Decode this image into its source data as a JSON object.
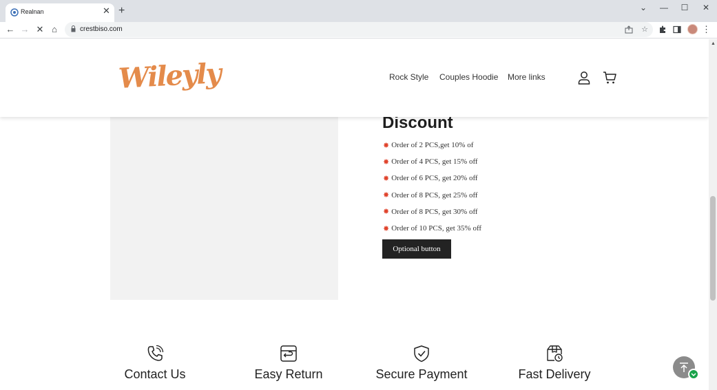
{
  "browser": {
    "tab_title": "Realnan",
    "tab_close": "✕",
    "new_tab": "+",
    "url": "crestbiso.com",
    "window_controls": {
      "chevron": "⌄",
      "minimize": "—",
      "maximize": "☐",
      "close": "✕"
    },
    "nav": {
      "back": "←",
      "forward": "→",
      "reload": "✕",
      "home": "⌂"
    },
    "icons": {
      "share": "share-icon",
      "bookmark": "star-icon",
      "extensions": "puzzle-icon",
      "sidepanel": "sidepanel-icon",
      "menu": "⋮"
    }
  },
  "header": {
    "logo_text": "Wileyly",
    "nav_links": [
      "Rock Style",
      "Couples Hoodie",
      "More links"
    ],
    "icons": {
      "account": "user-icon",
      "cart": "cart-icon"
    }
  },
  "discount": {
    "title": "Discount",
    "star_glyph": "✸",
    "items": [
      "Order of 2 PCS,get 10% of",
      "Order of 4 PCS, get 15% off",
      "Order of 6 PCS, get 20% off",
      "Order of 8 PCS, get 25% off",
      "Order of 8 PCS, get 30% off",
      "Order of 10 PCS, get 35% off"
    ],
    "button_label": "Optional button"
  },
  "features": [
    {
      "label": "Contact Us",
      "icon": "phone-icon"
    },
    {
      "label": "Easy Return",
      "icon": "return-box-icon"
    },
    {
      "label": "Secure Payment",
      "icon": "shield-check-icon"
    },
    {
      "label": "Fast Delivery",
      "icon": "delivery-box-icon"
    }
  ],
  "colors": {
    "logo": "#e48b4b",
    "button_bg": "#232323",
    "star": "#e0442d",
    "placeholder": "#f2f2f2"
  }
}
